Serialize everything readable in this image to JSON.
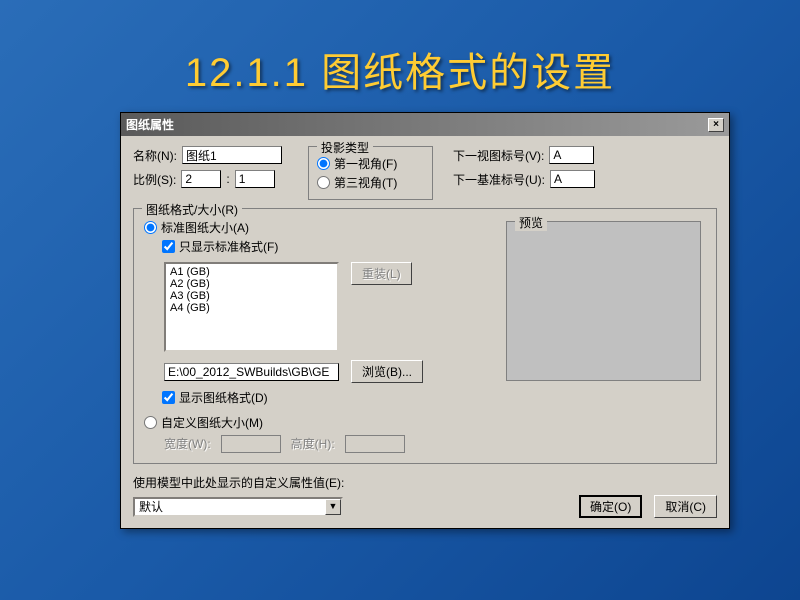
{
  "slide": {
    "title": "12.1.1  图纸格式的设置"
  },
  "dialog": {
    "title": "图纸属性",
    "close": "×",
    "name": {
      "label": "名称(N):",
      "value": "图纸1"
    },
    "scale": {
      "label": "比例(S):",
      "num": "2",
      "sep": ":",
      "den": "1"
    },
    "projection": {
      "group": "投影类型",
      "first": "第一视角(F)",
      "third": "第三视角(T)"
    },
    "next_view": {
      "label": "下一视图标号(V):",
      "value": "A"
    },
    "next_datum": {
      "label": "下一基准标号(U):",
      "value": "A"
    },
    "format_group": {
      "title": "图纸格式/大小(R)",
      "standard_radio": "标准图纸大小(A)",
      "only_standard": "只显示标准格式(F)",
      "list": [
        "A1 (GB)",
        "A2 (GB)",
        "A3 (GB)",
        "A4 (GB)"
      ],
      "reload_btn": "重装(L)",
      "path": "E:\\00_2012_SWBuilds\\GB\\GE",
      "browse_btn": "浏览(B)...",
      "show_format": "显示图纸格式(D)",
      "custom_radio": "自定义图纸大小(M)",
      "width_label": "宽度(W):",
      "height_label": "高度(H):",
      "preview_label": "预览"
    },
    "custom_prop": {
      "label": "使用模型中此处显示的自定义属性值(E):",
      "value": "默认"
    },
    "ok_btn": "确定(O)",
    "cancel_btn": "取消(C)"
  }
}
